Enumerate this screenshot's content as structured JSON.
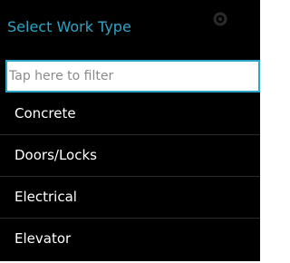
{
  "dialog": {
    "title": "Select Work Type",
    "filter_placeholder": "Tap here to filter",
    "filter_value": "",
    "items": [
      {
        "label": "Concrete"
      },
      {
        "label": "Doors/Locks"
      },
      {
        "label": "Electrical"
      },
      {
        "label": "Elevator"
      }
    ]
  },
  "colors": {
    "background": "#000000",
    "title_text": "#2ea5c6",
    "accent": "#2ea5c6",
    "item_text": "#ffffff",
    "divider": "#2b2b2b",
    "filter_background": "#ffffff",
    "placeholder_text": "#8a8a8a",
    "ghost_icon": "#2a2a2a"
  },
  "icons": {
    "title_bar_icon": "settings-gear-icon"
  }
}
